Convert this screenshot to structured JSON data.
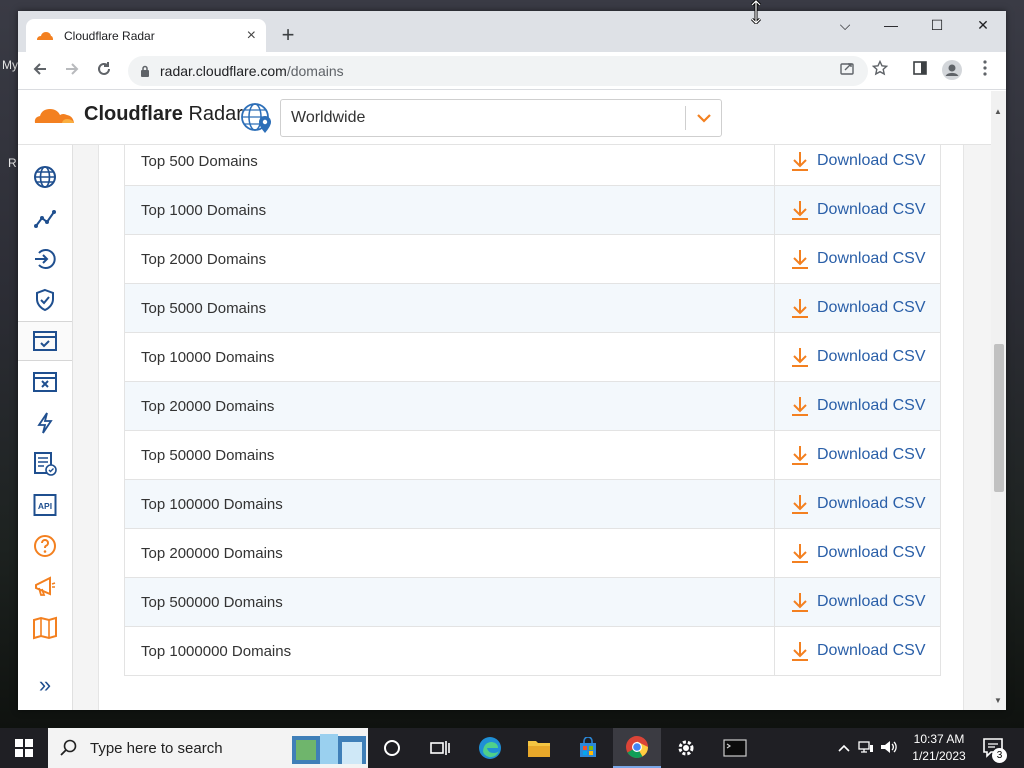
{
  "desktop": {
    "edge_labels": [
      "My",
      "R"
    ]
  },
  "browser": {
    "tab_title": "Cloudflare Radar",
    "tab_close": "×",
    "new_tab": "+",
    "url_host": "radar.cloudflare.com",
    "url_path": "/domains",
    "window_controls": {
      "dropdown": "⌵",
      "minimize": "—",
      "maximize": "☐",
      "close": "✕"
    }
  },
  "header": {
    "brand_bold": "Cloudflare",
    "brand_light": "Radar",
    "region": "Worldwide"
  },
  "sidebar": {
    "icons": [
      "globe-icon",
      "traffic-trend-icon",
      "login-arrow-icon",
      "security-shield-icon",
      "domains-browser-check-icon",
      "outage-browser-x-icon",
      "lightning-icon",
      "reports-icon",
      "api-icon",
      "help-icon",
      "announcement-icon",
      "map-book-icon"
    ],
    "active_index": 4,
    "expand": "»"
  },
  "downloads": {
    "rows": [
      {
        "label": "Top 500 Domains",
        "action": "Download CSV"
      },
      {
        "label": "Top 1000 Domains",
        "action": "Download CSV"
      },
      {
        "label": "Top 2000 Domains",
        "action": "Download CSV"
      },
      {
        "label": "Top 5000 Domains",
        "action": "Download CSV"
      },
      {
        "label": "Top 10000 Domains",
        "action": "Download CSV"
      },
      {
        "label": "Top 20000 Domains",
        "action": "Download CSV"
      },
      {
        "label": "Top 50000 Domains",
        "action": "Download CSV"
      },
      {
        "label": "Top 100000 Domains",
        "action": "Download CSV"
      },
      {
        "label": "Top 200000 Domains",
        "action": "Download CSV"
      },
      {
        "label": "Top 500000 Domains",
        "action": "Download CSV"
      },
      {
        "label": "Top 1000000 Domains",
        "action": "Download CSV"
      }
    ]
  },
  "taskbar": {
    "search_placeholder": "Type here to search",
    "time": "10:37 AM",
    "date": "1/21/2023",
    "notification_count": "3"
  },
  "colors": {
    "accent_orange": "#f38020",
    "link_blue": "#2a5fa8",
    "row_alt": "#f3f8fc"
  }
}
